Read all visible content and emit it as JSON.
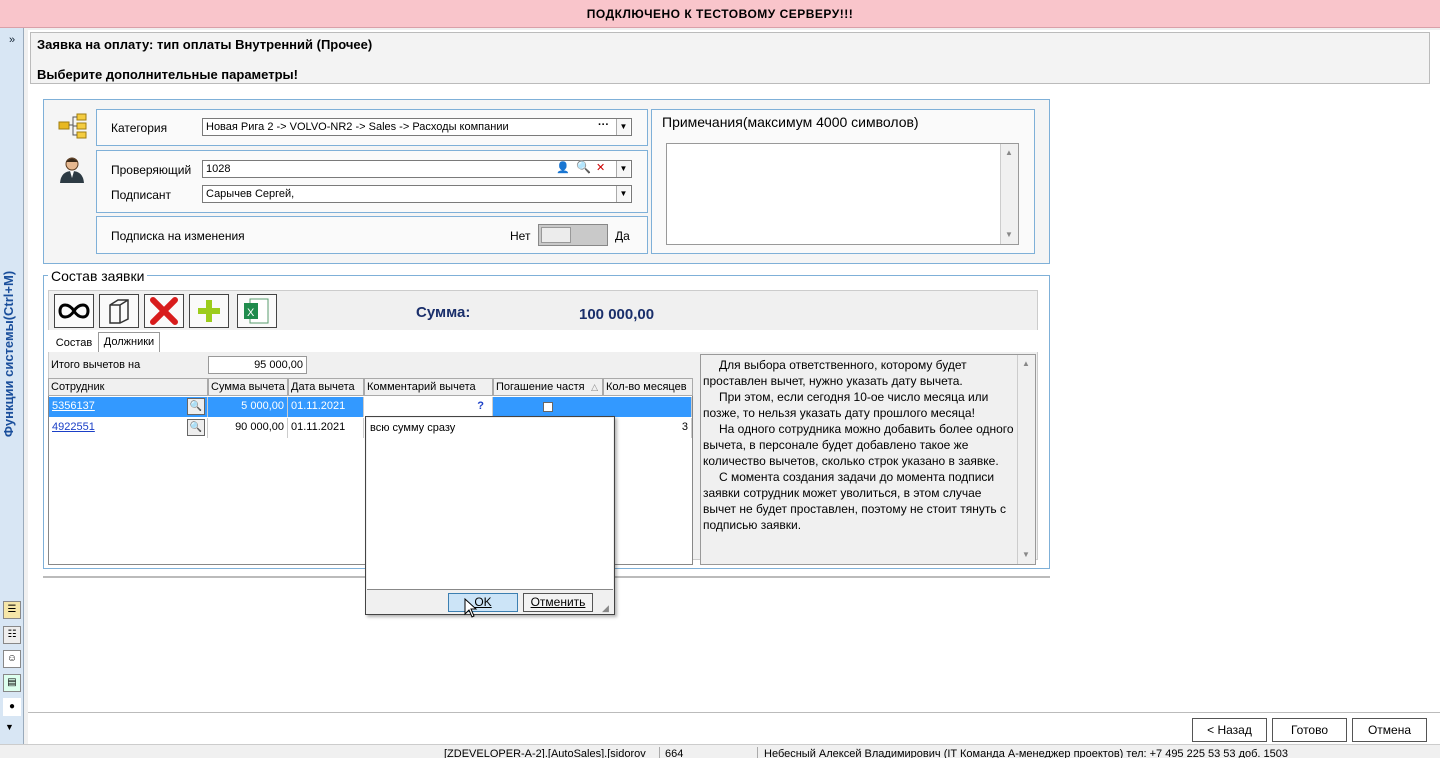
{
  "banner": "ПОДКЛЮЧЕНО К ТЕСТОВОМУ СЕРВЕРУ!!!",
  "sidebar": {
    "expand": "»",
    "vertical_label": "Функции системы(Ctrl+M)"
  },
  "header": {
    "title": "Заявка на оплату: тип оплаты Внутренний (Прочее)",
    "subtitle": "Выберите дополнительные параметры!"
  },
  "form": {
    "category_label": "Категория",
    "category_value": "Новая Рига 2 -> VOLVO-NR2 -> Sales -> Расходы компании",
    "category_more": "···",
    "reviewer_label": "Проверяющий",
    "reviewer_value": "1028",
    "signer_label": "Подписант",
    "signer_value": "Сарычев Сергей,",
    "subscription_label": "Подписка на изменения",
    "toggle_no": "Нет",
    "toggle_yes": "Да",
    "notes_label": "Примечания(максимум 4000 символов)"
  },
  "composition": {
    "title": "Состав заявки",
    "sum_label": "Сумма:",
    "sum_value": "100 000,00",
    "tabs": [
      {
        "label": "Состав"
      },
      {
        "label": "Должники"
      }
    ],
    "total_label": "Итого вычетов на",
    "total_value": "95 000,00",
    "columns": [
      "Сотрудник",
      "Сумма вычета",
      "Дата вычета",
      "Комментарий вычета",
      "Погашение частя",
      "Кол-во месяцев"
    ],
    "rows": [
      {
        "employee": "5356137",
        "amount": "5 000,00",
        "date": "01.11.2021",
        "comment": "",
        "comment_mark": "?",
        "months": ""
      },
      {
        "employee": "4922551",
        "amount": "90 000,00",
        "date": "01.11.2021",
        "comment": "",
        "comment_mark": "",
        "months": "3"
      }
    ],
    "help_text": [
      "Для выбора ответственного, которому будет проставлен вычет, нужно указать дату вычета.",
      "При этом, если сегодня 10-ое число месяца или позже, то нельзя указать дату прошлого месяца!",
      "На одного сотрудника можно добавить более одного вычета, в персонале будет добавлено такое же количество вычетов, сколько строк указано в заявке.",
      "С момента создания задачи до момента подписи заявки сотрудник может уволиться, в этом случае вычет не будет проставлен, поэтому не стоит тянуть с подписью заявки."
    ]
  },
  "popup": {
    "text": "всю сумму сразу",
    "ok_label": "OK",
    "cancel_label": "Отменить"
  },
  "footer": {
    "back_label": "< Назад",
    "done_label": "Готово",
    "cancel_label": "Отмена"
  },
  "status": {
    "session": "[ZDEVELOPER-A-2].[AutoSales].[sidorov",
    "code": "664",
    "user": "Небесный Алексей Владимирович (IT Команда А-менеджер проектов) тел: +7 495 225 53 53 доб. 1503"
  },
  "colors": {
    "banner": "#f9c5cb",
    "accent_blue": "#1a4f9c",
    "selected_row": "#3399ff",
    "box_border": "#7fb0d8"
  }
}
